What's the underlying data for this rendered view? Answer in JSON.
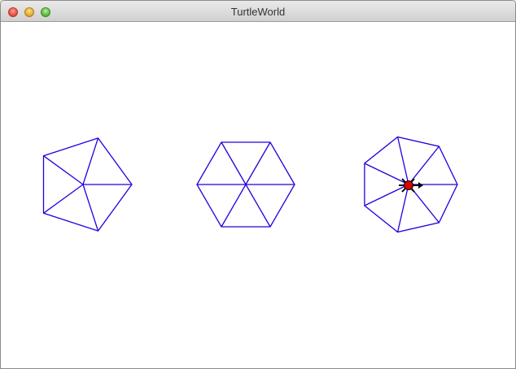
{
  "window": {
    "title": "TurtleWorld"
  },
  "controls": {
    "close_icon": "close-icon",
    "minimize_icon": "minimize-icon",
    "zoom_icon": "zoom-icon"
  },
  "canvas": {
    "line_color": "#2200dd",
    "background": "#ffffff",
    "shapes": [
      {
        "name": "pentagon",
        "sides": 5
      },
      {
        "name": "hexagon",
        "sides": 6
      },
      {
        "name": "heptagon",
        "sides": 7
      }
    ],
    "turtle": {
      "body_color": "#dd0000",
      "heading": "east"
    }
  }
}
